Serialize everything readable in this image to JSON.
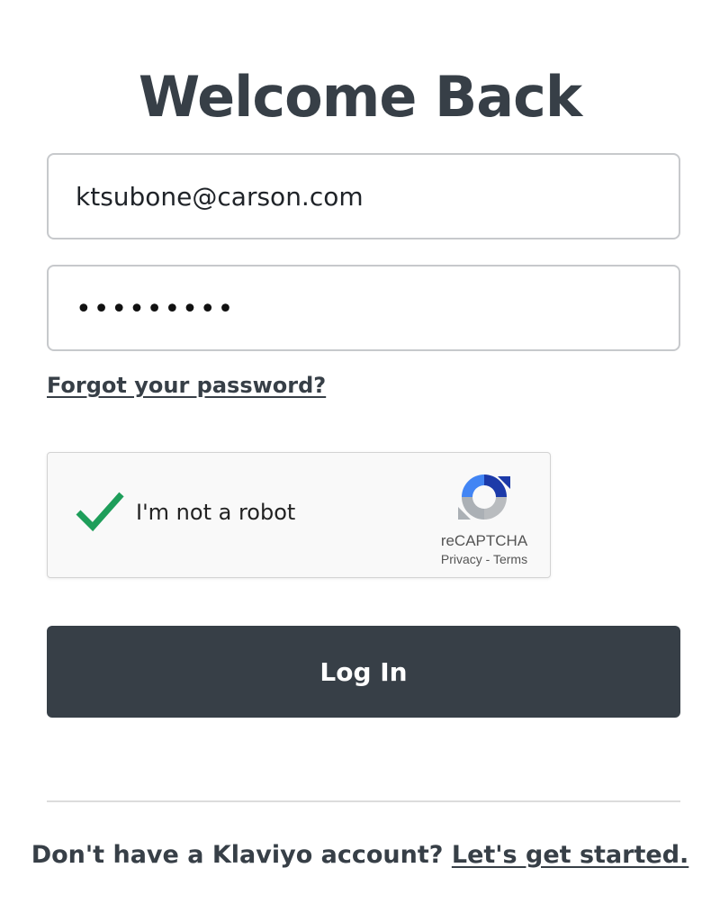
{
  "page": {
    "title": "Welcome Back"
  },
  "form": {
    "email_value": "ktsubone@carson.com",
    "password_masked": "•••••••••",
    "forgot_link": "Forgot your password?",
    "login_label": "Log In"
  },
  "recaptcha": {
    "label": "I'm not a robot",
    "checked": true,
    "brand": "reCAPTCHA",
    "privacy": "Privacy",
    "separator": "-",
    "terms": "Terms",
    "check_icon": "checkmark-icon",
    "logo_icon": "recaptcha-logo-icon"
  },
  "footer": {
    "prompt": "Don't have a Klaviyo account?",
    "signup_link": "Let's get started."
  },
  "colors": {
    "primary_dark": "#373f47",
    "check_green": "#1e9e5a",
    "border": "#c7c9cc"
  }
}
